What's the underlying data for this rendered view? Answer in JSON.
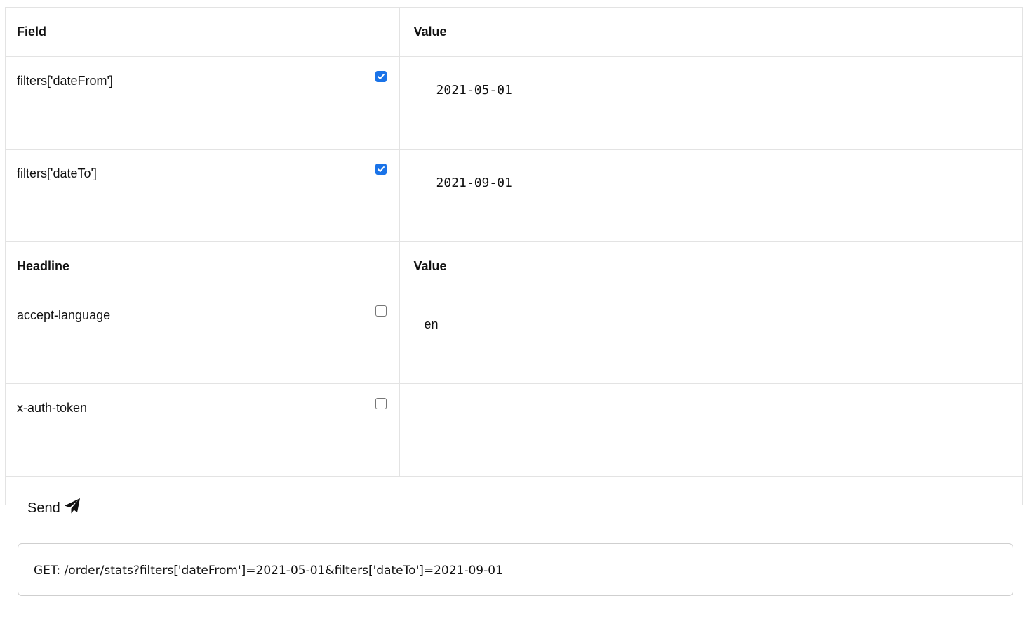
{
  "fields_section": {
    "header_name": "Field",
    "header_value": "Value",
    "rows": [
      {
        "name": "filters['dateFrom']",
        "checked": true,
        "value": "2021-05-01"
      },
      {
        "name": "filters['dateTo']",
        "checked": true,
        "value": "2021-09-01"
      }
    ]
  },
  "headers_section": {
    "header_name": "Headline",
    "header_value": "Value",
    "rows": [
      {
        "name": "accept-language",
        "checked": false,
        "value": "en"
      },
      {
        "name": "x-auth-token",
        "checked": false,
        "value": ""
      }
    ]
  },
  "send_button": {
    "label": "Send",
    "icon": "paper-plane-icon"
  },
  "request_preview": "GET: /order/stats?filters['dateFrom']=2021-05-01&filters['dateTo']=2021-09-01",
  "colors": {
    "checkbox_checked": "#1a73e8",
    "border": "#e3e3e3"
  }
}
